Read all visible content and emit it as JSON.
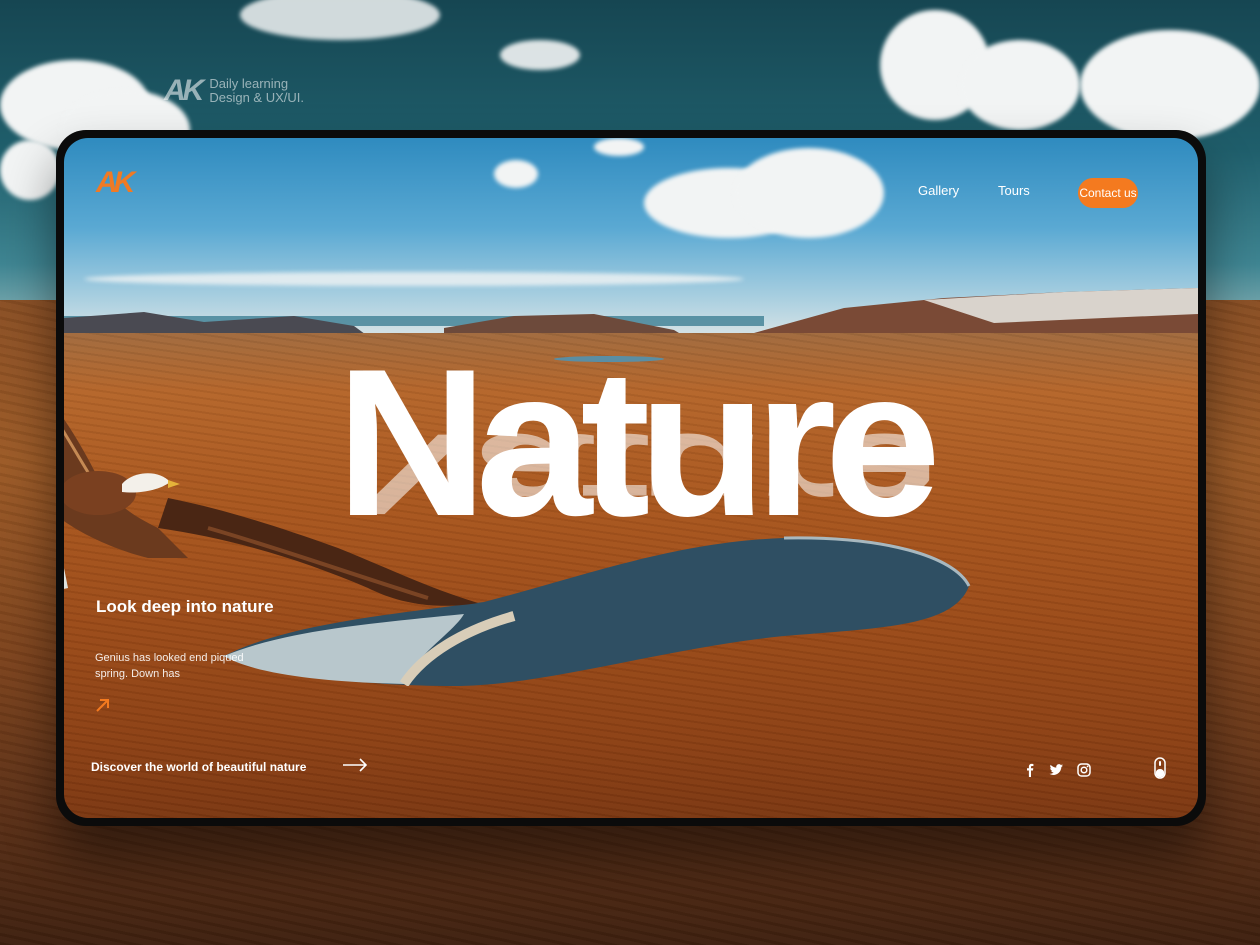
{
  "backdrop": {
    "brand_mark": "AK",
    "brand_line1": "Daily learning",
    "brand_line2": "Design & UX/UI."
  },
  "header": {
    "logo": "AK",
    "nav": [
      {
        "label": "Gallery"
      },
      {
        "label": "Tours"
      }
    ],
    "cta_label": "Contact us"
  },
  "hero": {
    "title": "Nature"
  },
  "feature": {
    "title": "Look deep into nature",
    "text": "Genius has looked end piqued spring. Down has"
  },
  "footer": {
    "discover_label": "Discover the world of beautiful nature",
    "social_icons": [
      "facebook-icon",
      "twitter-icon",
      "instagram-icon"
    ],
    "scroll_icon": "mouse-scroll-icon"
  },
  "colors": {
    "accent": "#f47a1f",
    "text": "#ffffff",
    "frame": "#0b0b0b"
  }
}
